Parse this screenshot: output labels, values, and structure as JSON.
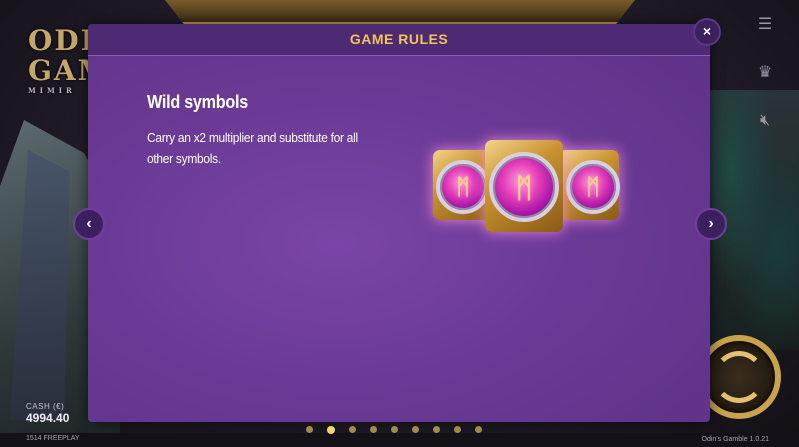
{
  "background": {
    "logo_text": "ODIN'S GAMBLE",
    "logo_sub": "MIMIR",
    "cash_label": "CASH (€)",
    "cash_value": "4994.40",
    "freeplay_text": "1514 FREEPLAY",
    "version_text": "Odin's Gamble 1.0.21"
  },
  "side_icons": [
    "menu-icon",
    "trophy-icon",
    "sound-off-icon"
  ],
  "modal": {
    "title": "GAME RULES",
    "close_label": "×",
    "section_title": "Wild symbols",
    "section_body": "Carry an x2 multiplier and substitute for all other symbols.",
    "prev_label": "‹",
    "next_label": "›",
    "symbol_rune": "ᛗ",
    "page_count": 9,
    "active_page": 2
  },
  "colors": {
    "title": "#f2c35a",
    "modal_bg": "#6b3a96",
    "header_bg": "#4f2a74",
    "dot": "#c9b45a"
  }
}
